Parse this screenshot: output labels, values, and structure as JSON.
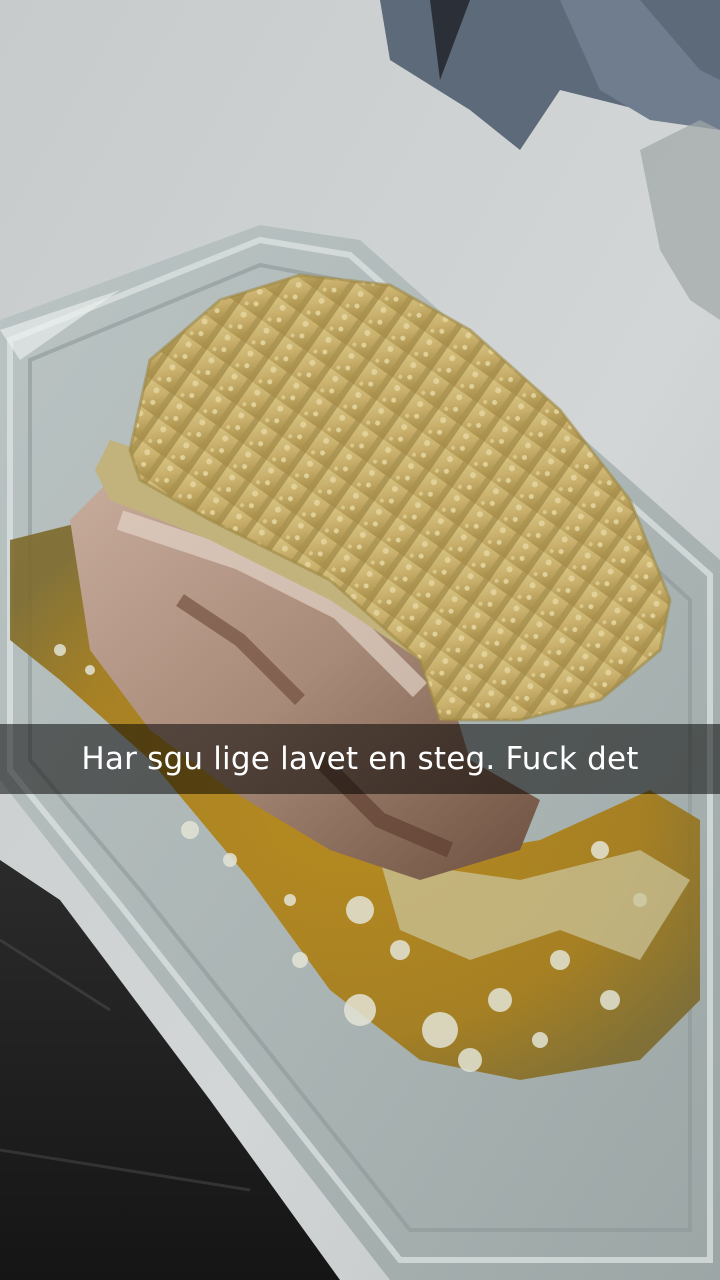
{
  "snap": {
    "caption": "Har sgu lige lavet en steg. Fuck det"
  },
  "colors": {
    "countertop": "#cfd3d4",
    "crackling": "#cfb97a",
    "meat": "#b59a8a",
    "juices": "#b58a1a",
    "glass_dish": "#aab4b3",
    "floor": "#1f1f1f",
    "towel": "#5d6a7a"
  }
}
